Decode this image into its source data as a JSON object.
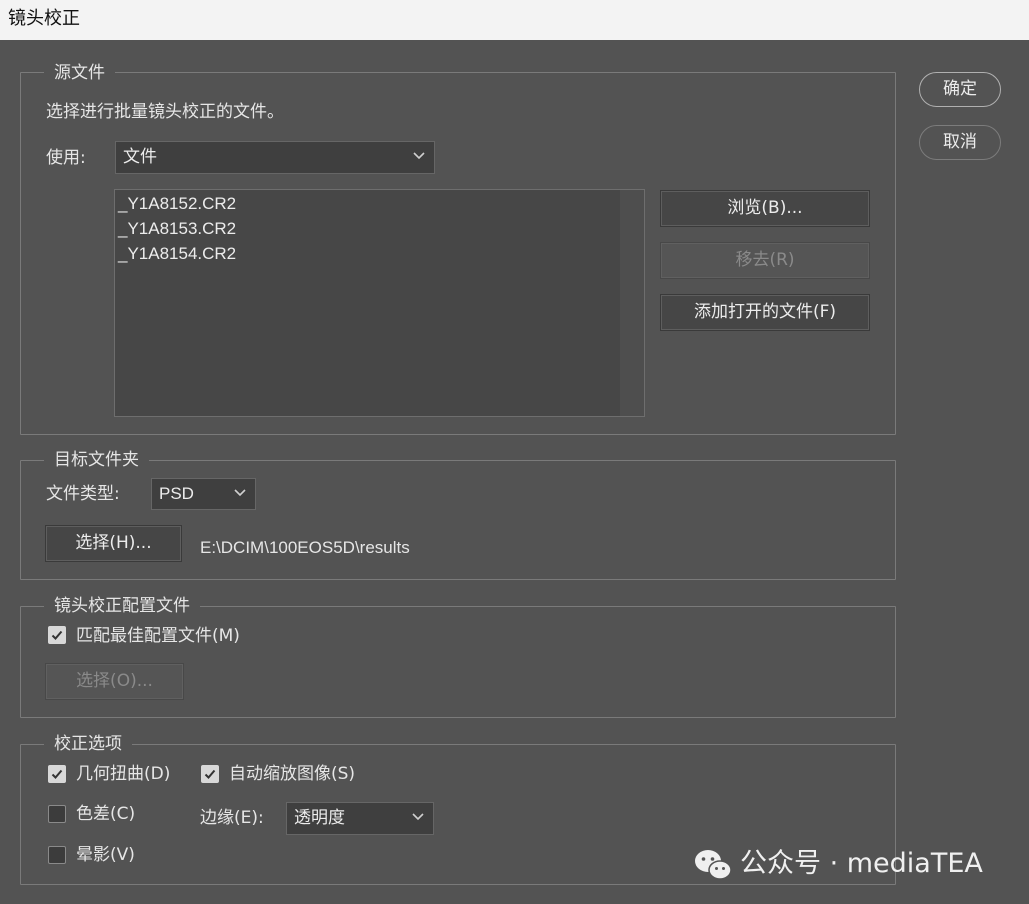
{
  "window": {
    "title": "镜头校正"
  },
  "actions": {
    "ok_label": "确定",
    "cancel_label": "取消"
  },
  "source": {
    "legend": "源文件",
    "description": "选择进行批量镜头校正的文件。",
    "use_label": "使用:",
    "use_value": "文件",
    "files": [
      "_Y1A8152.CR2",
      "_Y1A8153.CR2",
      "_Y1A8154.CR2"
    ],
    "browse_label": "浏览(B)...",
    "remove_label": "移去(R)",
    "add_open_label": "添加打开的文件(F)"
  },
  "destination": {
    "legend": "目标文件夹",
    "file_type_label": "文件类型:",
    "file_type_value": "PSD",
    "choose_label": "选择(H)...",
    "path": "E:\\DCIM\\100EOS5D\\results"
  },
  "profile": {
    "legend": "镜头校正配置文件",
    "match_label": "匹配最佳配置文件(M)",
    "match_checked": true,
    "choose_label": "选择(O)..."
  },
  "options": {
    "legend": "校正选项",
    "geometric_label": "几何扭曲(D)",
    "geometric_checked": true,
    "auto_scale_label": "自动缩放图像(S)",
    "auto_scale_checked": true,
    "chromatic_label": "色差(C)",
    "chromatic_checked": false,
    "vignette_label": "晕影(V)",
    "vignette_checked": false,
    "edge_label": "边缘(E):",
    "edge_value": "透明度"
  },
  "watermark": {
    "text": "公众号 · mediaTEA",
    "icon": "wechat-icon"
  },
  "colors": {
    "background": "#535353",
    "titlebar": "#f3f3f3"
  }
}
